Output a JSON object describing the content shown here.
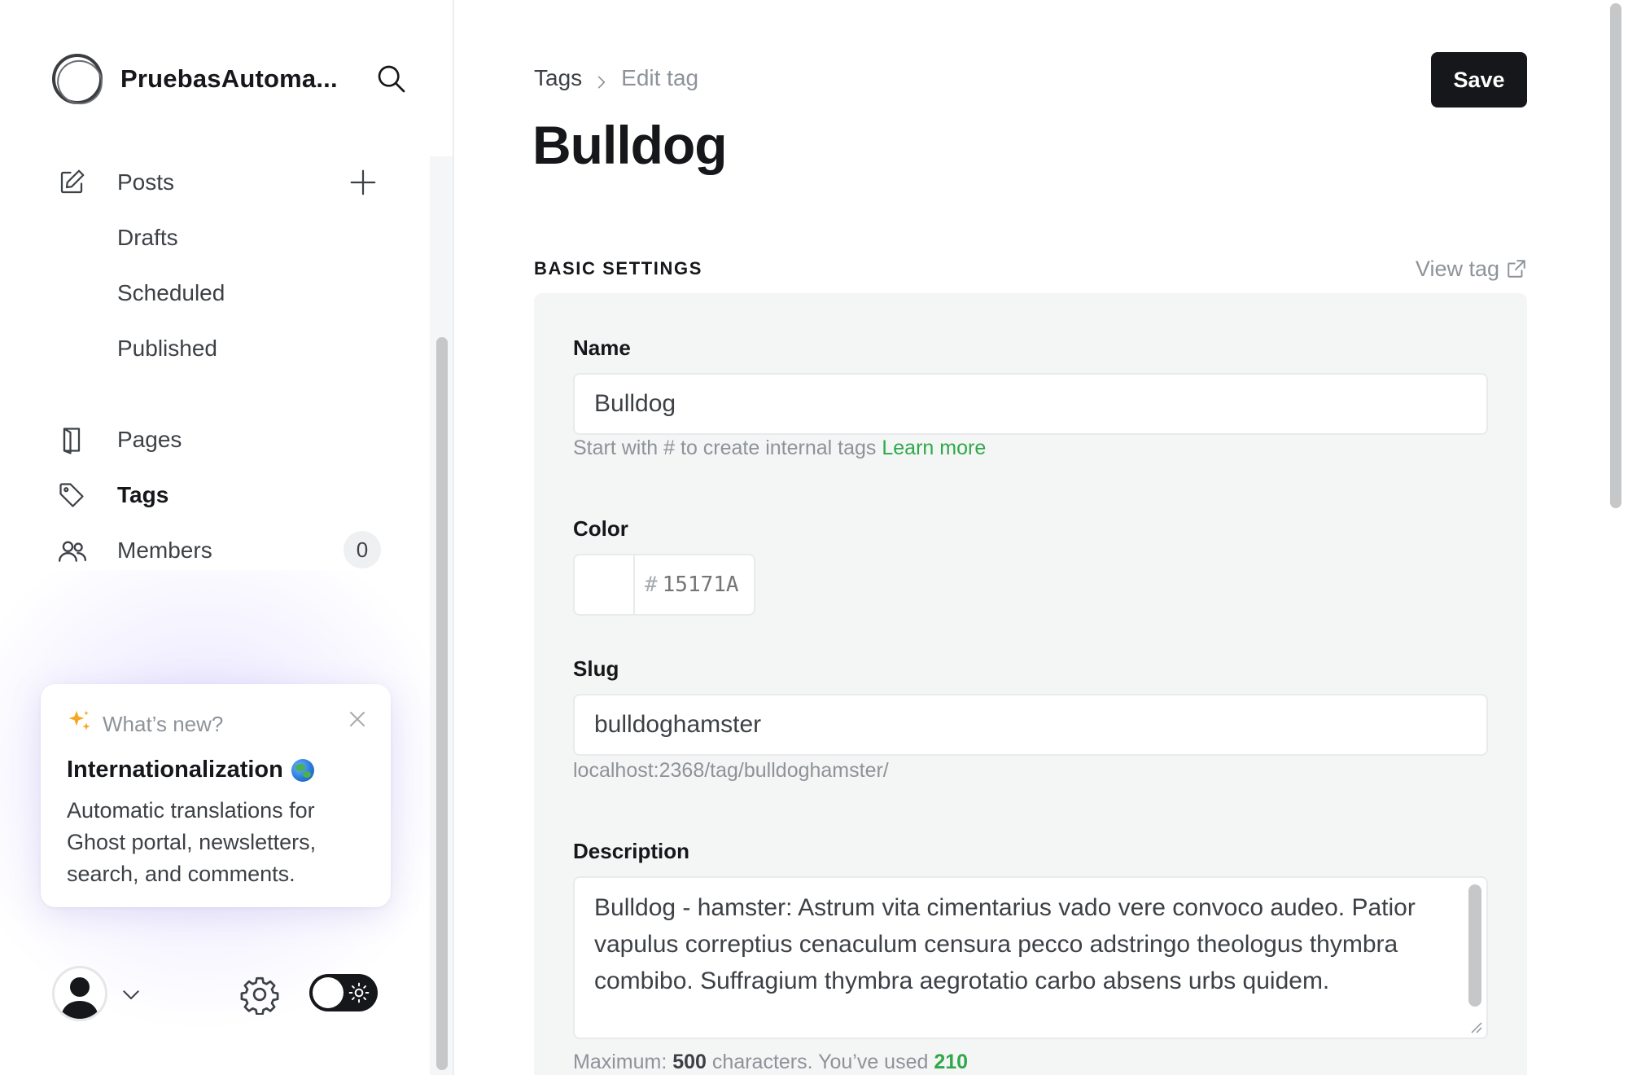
{
  "sidebar": {
    "site_name": "PruebasAutoma...",
    "nav": {
      "posts": "Posts",
      "drafts": "Drafts",
      "scheduled": "Scheduled",
      "published": "Published",
      "pages": "Pages",
      "tags": "Tags",
      "members": "Members",
      "members_count": "0"
    },
    "whats_new": {
      "heading": "What’s new?",
      "title": "Internationalization",
      "description": "Automatic translations for Ghost portal, newsletters, search, and comments."
    }
  },
  "main": {
    "breadcrumb": {
      "parent": "Tags",
      "current": "Edit tag"
    },
    "title": "Bulldog",
    "save_label": "Save",
    "section": {
      "title": "BASIC SETTINGS",
      "view_tag": "View tag"
    },
    "form": {
      "name_label": "Name",
      "name_value": "Bulldog",
      "name_hint": "Start with # to create internal tags",
      "name_hint_link": "Learn more",
      "color_label": "Color",
      "color_hash": "#",
      "color_placeholder": "15171A",
      "slug_label": "Slug",
      "slug_value": "bulldoghamster",
      "slug_url": "localhost:2368/tag/bulldoghamster/",
      "description_label": "Description",
      "description_value": "Bulldog - hamster: Astrum vita cimentarius vado vere convoco audeo. Patior vapulus correptius cenaculum censura pecco adstringo theologus thymbra combibo. Suffragium thymbra aegrotatio carbo absens urbs quidem.",
      "max_prefix": "Maximum:",
      "max_count": "500",
      "used_prefix": "characters. You’ve used",
      "used_count": "210"
    }
  },
  "colors": {
    "accent_green": "#30a84a",
    "primary_dark": "#15171a",
    "panel_bg": "#f4f5f5"
  }
}
